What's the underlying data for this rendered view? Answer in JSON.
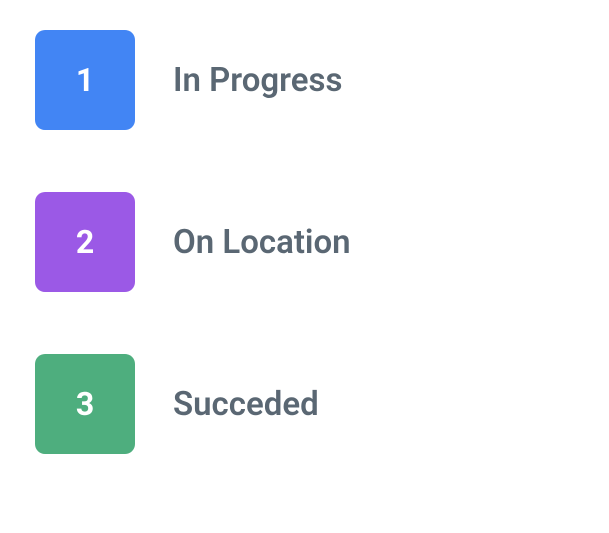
{
  "steps": [
    {
      "number": "1",
      "label": "In Progress",
      "color": "#4285f4"
    },
    {
      "number": "2",
      "label": "On Location",
      "color": "#9b59e6"
    },
    {
      "number": "3",
      "label": "Succeded",
      "color": "#4eae7e"
    }
  ]
}
